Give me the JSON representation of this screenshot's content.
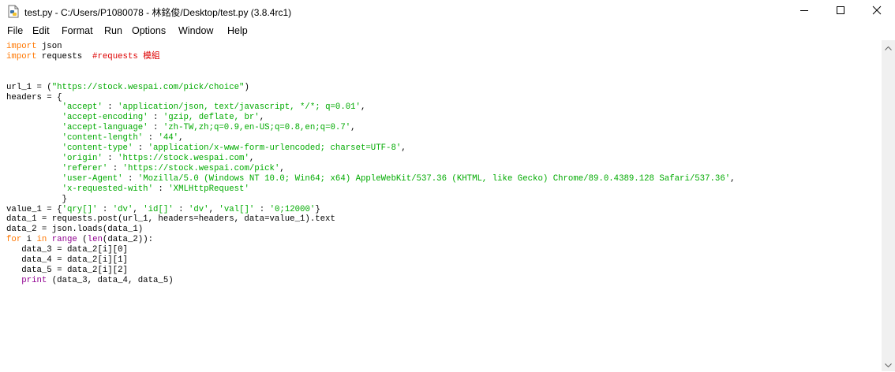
{
  "window": {
    "title": "test.py - C:/Users/P1080078 - 林銘俊/Desktop/test.py (3.8.4rc1)",
    "icon": "python-file-icon",
    "controls": [
      "minimize-icon",
      "maximize-icon",
      "close-icon"
    ]
  },
  "menu": {
    "items": [
      "File",
      "Edit",
      "Format",
      "Run",
      "Options",
      "Window",
      "Help"
    ]
  },
  "code": {
    "lines": [
      [
        [
          "kw",
          "import"
        ],
        [
          "t",
          " json"
        ]
      ],
      [
        [
          "kw",
          "import"
        ],
        [
          "t",
          " requests  "
        ],
        [
          "cm",
          "#requests 模組"
        ]
      ],
      [],
      [],
      [
        [
          "t",
          "url_1 = ("
        ],
        [
          "str",
          "\"https://stock.wespai.com/pick/choice\""
        ],
        [
          "t",
          ")"
        ]
      ],
      [
        [
          "t",
          "headers = {"
        ]
      ],
      [
        [
          "t",
          "           "
        ],
        [
          "str",
          "'accept'"
        ],
        [
          "t",
          " : "
        ],
        [
          "str",
          "'application/json, text/javascript, */*; q=0.01'"
        ],
        [
          "t",
          ","
        ]
      ],
      [
        [
          "t",
          "           "
        ],
        [
          "str",
          "'accept-encoding'"
        ],
        [
          "t",
          " : "
        ],
        [
          "str",
          "'gzip, deflate, br'"
        ],
        [
          "t",
          ","
        ]
      ],
      [
        [
          "t",
          "           "
        ],
        [
          "str",
          "'accept-language'"
        ],
        [
          "t",
          " : "
        ],
        [
          "str",
          "'zh-TW,zh;q=0.9,en-US;q=0.8,en;q=0.7'"
        ],
        [
          "t",
          ","
        ]
      ],
      [
        [
          "t",
          "           "
        ],
        [
          "str",
          "'content-length'"
        ],
        [
          "t",
          " : "
        ],
        [
          "str",
          "'44'"
        ],
        [
          "t",
          ","
        ]
      ],
      [
        [
          "t",
          "           "
        ],
        [
          "str",
          "'content-type'"
        ],
        [
          "t",
          " : "
        ],
        [
          "str",
          "'application/x-www-form-urlencoded; charset=UTF-8'"
        ],
        [
          "t",
          ","
        ]
      ],
      [
        [
          "t",
          "           "
        ],
        [
          "str",
          "'origin'"
        ],
        [
          "t",
          " : "
        ],
        [
          "str",
          "'https://stock.wespai.com'"
        ],
        [
          "t",
          ","
        ]
      ],
      [
        [
          "t",
          "           "
        ],
        [
          "str",
          "'referer'"
        ],
        [
          "t",
          " : "
        ],
        [
          "str",
          "'https://stock.wespai.com/pick'"
        ],
        [
          "t",
          ","
        ]
      ],
      [
        [
          "t",
          "           "
        ],
        [
          "str",
          "'user-Agent'"
        ],
        [
          "t",
          " : "
        ],
        [
          "str",
          "'Mozilla/5.0 (Windows NT 10.0; Win64; x64) AppleWebKit/537.36 (KHTML, like Gecko) Chrome/89.0.4389.128 Safari/537.36'"
        ],
        [
          "t",
          ","
        ]
      ],
      [
        [
          "t",
          "           "
        ],
        [
          "str",
          "'x-requested-with'"
        ],
        [
          "t",
          " : "
        ],
        [
          "str",
          "'XMLHttpRequest'"
        ]
      ],
      [
        [
          "t",
          "           }"
        ]
      ],
      [
        [
          "t",
          "value_1 = {"
        ],
        [
          "str",
          "'qry[]'"
        ],
        [
          "t",
          " : "
        ],
        [
          "str",
          "'dv'"
        ],
        [
          "t",
          ", "
        ],
        [
          "str",
          "'id[]'"
        ],
        [
          "t",
          " : "
        ],
        [
          "str",
          "'dv'"
        ],
        [
          "t",
          ", "
        ],
        [
          "str",
          "'val[]'"
        ],
        [
          "t",
          " : "
        ],
        [
          "str",
          "'0;12000'"
        ],
        [
          "t",
          "}"
        ]
      ],
      [
        [
          "t",
          "data_1 = requests.post(url_1, headers=headers, data=value_1).text"
        ]
      ],
      [
        [
          "t",
          "data_2 = json.loads(data_1)"
        ]
      ],
      [
        [
          "kw",
          "for"
        ],
        [
          "t",
          " i "
        ],
        [
          "kw",
          "in"
        ],
        [
          "t",
          " "
        ],
        [
          "bi",
          "range"
        ],
        [
          "t",
          " ("
        ],
        [
          "bi",
          "len"
        ],
        [
          "t",
          "(data_2)):"
        ]
      ],
      [
        [
          "t",
          "   data_3 = data_2[i][0]"
        ]
      ],
      [
        [
          "t",
          "   data_4 = data_2[i][1]"
        ]
      ],
      [
        [
          "t",
          "   data_5 = data_2[i][2]"
        ]
      ],
      [
        [
          "t",
          "   "
        ],
        [
          "bi",
          "print"
        ],
        [
          "t",
          " (data_3, data_4, data_5)"
        ]
      ]
    ]
  },
  "colors": {
    "keyword": "#ff7700",
    "builtin": "#900090",
    "string": "#00aa00",
    "comment": "#dd0000",
    "text": "#000000"
  }
}
